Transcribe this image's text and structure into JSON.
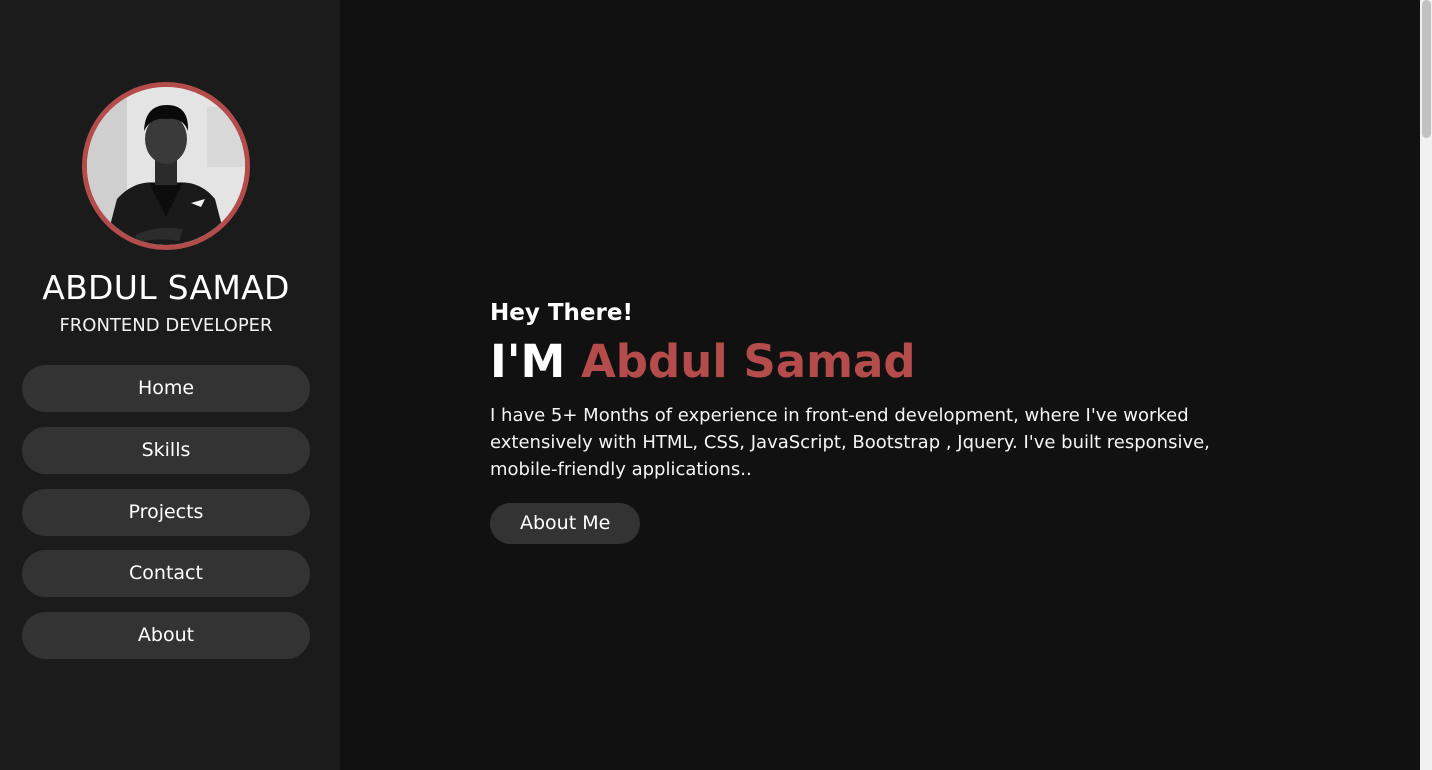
{
  "sidebar": {
    "name": "ABDUL SAMAD",
    "role": "FRONTEND DEVELOPER",
    "nav": [
      {
        "label": "Home"
      },
      {
        "label": "Skills"
      },
      {
        "label": "Projects"
      },
      {
        "label": "Contact"
      },
      {
        "label": "About"
      }
    ]
  },
  "hero": {
    "greeting": "Hey There!",
    "headline_prefix": "I'M",
    "headline_name": "Abdul Samad",
    "bio": "I have 5+ Months of experience in front-end development, where I've worked extensively with HTML, CSS, JavaScript, Bootstrap , Jquery. I've built responsive, mobile-friendly applications..",
    "cta": "About Me"
  },
  "colors": {
    "accent": "#b54c4c",
    "background": "#111111",
    "sidebar": "#1b1b1b",
    "button": "#333333"
  }
}
